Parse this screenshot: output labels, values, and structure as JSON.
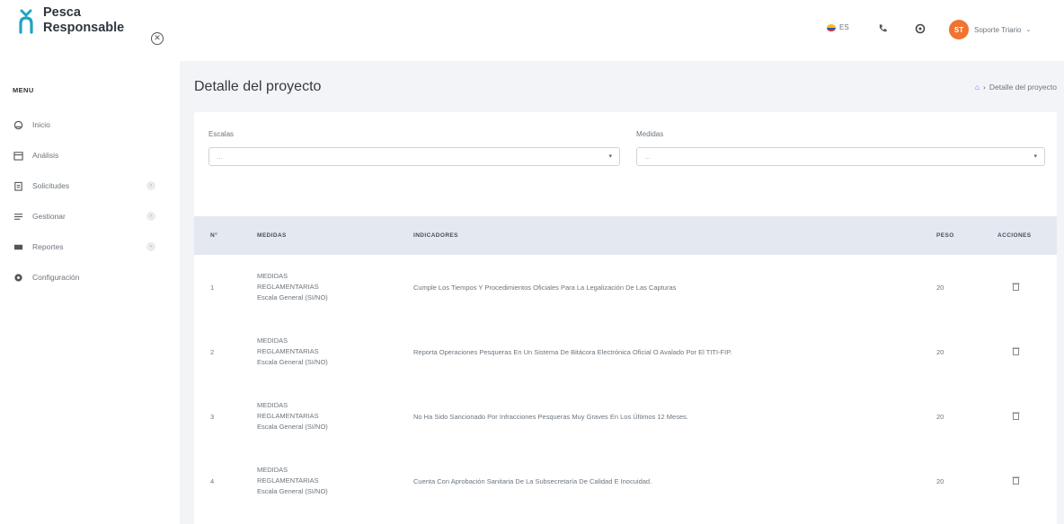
{
  "app": {
    "name_line1": "Pesca",
    "name_line2": "Responsable"
  },
  "sidebar": {
    "menu_title": "MENU",
    "items": [
      {
        "label": "Inicio",
        "icon": "home-icon",
        "has_arrow": false
      },
      {
        "label": "Análisis",
        "icon": "calendar-icon",
        "has_arrow": false
      },
      {
        "label": "Solicitudes",
        "icon": "clipboard-icon",
        "has_arrow": true
      },
      {
        "label": "Gestionar",
        "icon": "list-icon",
        "has_arrow": true
      },
      {
        "label": "Reportes",
        "icon": "chart-icon",
        "has_arrow": true
      },
      {
        "label": "Configuración",
        "icon": "gear-icon",
        "has_arrow": false
      }
    ]
  },
  "topbar": {
    "language": "ES",
    "user_initials": "ST",
    "user_name": "Soporte Triario"
  },
  "page": {
    "title": "Detalle del proyecto",
    "breadcrumb": "Detalle del proyecto"
  },
  "filters": {
    "escalas_label": "Escalas",
    "escalas_value": "...",
    "medidas_label": "Medidas",
    "medidas_value": "..."
  },
  "table": {
    "headers": {
      "num": "N°",
      "medidas": "MEDIDAS",
      "indicadores": "INDICADORES",
      "peso": "PESO",
      "acciones": "ACCIONES"
    },
    "rows": [
      {
        "num": "1",
        "medida_1": "MEDIDAS",
        "medida_2": "REGLAMENTARIAS",
        "medida_3": "Escala General (SI/NO)",
        "indicador": "Cumple Los Tiempos Y Procedimientos Oficiales Para La Legalización De Las Capturas",
        "peso": "20"
      },
      {
        "num": "2",
        "medida_1": "MEDIDAS",
        "medida_2": "REGLAMENTARIAS",
        "medida_3": "Escala General (SI/NO)",
        "indicador": "Reporta Operaciones Pesqueras En Un Sistema De Bitácora Electrónica Oficial O Avalado Por El TITI-FIP.",
        "peso": "20"
      },
      {
        "num": "3",
        "medida_1": "MEDIDAS",
        "medida_2": "REGLAMENTARIAS",
        "medida_3": "Escala General (SI/NO)",
        "indicador": "No Ha Sido Sancionado Por Infracciones Pesqueras Muy Graves En Los Últimos 12 Meses.",
        "peso": "20"
      },
      {
        "num": "4",
        "medida_1": "MEDIDAS",
        "medida_2": "REGLAMENTARIAS",
        "medida_3": "Escala General (SI/NO)",
        "indicador": "Cuenta Con Aprobación Sanitaria De La Subsecretaría De Calidad E Inocuidad.",
        "peso": "20"
      }
    ]
  },
  "colors": {
    "accent": "#5b73e8",
    "logo": "#20a3c4",
    "avatar": "#f1732e",
    "table_header": "#e3e8f1"
  }
}
